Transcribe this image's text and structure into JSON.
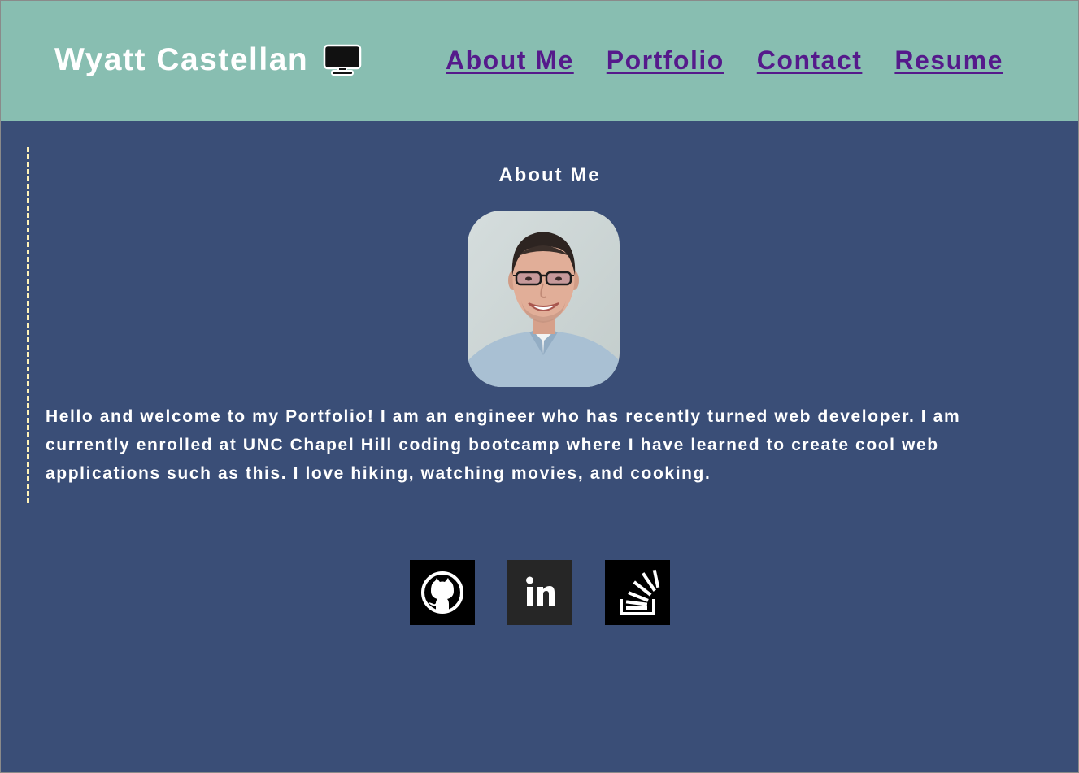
{
  "header": {
    "site_title": "Wyatt Castellan",
    "title_icon": "monitor-icon",
    "nav": [
      {
        "label": "About Me"
      },
      {
        "label": "Portfolio"
      },
      {
        "label": "Contact"
      },
      {
        "label": "Resume"
      }
    ]
  },
  "about": {
    "heading": "About Me",
    "photo_alt": "profile photo",
    "text": "Hello and welcome to my Portfolio! I am an engineer who has recently turned web developer. I am currently enrolled at UNC Chapel Hill coding bootcamp where I have learned to create cool web applications such as this. I love hiking, watching movies, and cooking."
  },
  "socials": [
    {
      "icon": "github-icon"
    },
    {
      "icon": "linkedin-icon"
    },
    {
      "icon": "stackoverflow-icon"
    }
  ],
  "colors": {
    "header_bg": "#88beb1",
    "page_bg": "#3a4e77",
    "nav_link": "#551a8b",
    "text": "#ffffff",
    "dashed_border": "#fff2b8"
  }
}
